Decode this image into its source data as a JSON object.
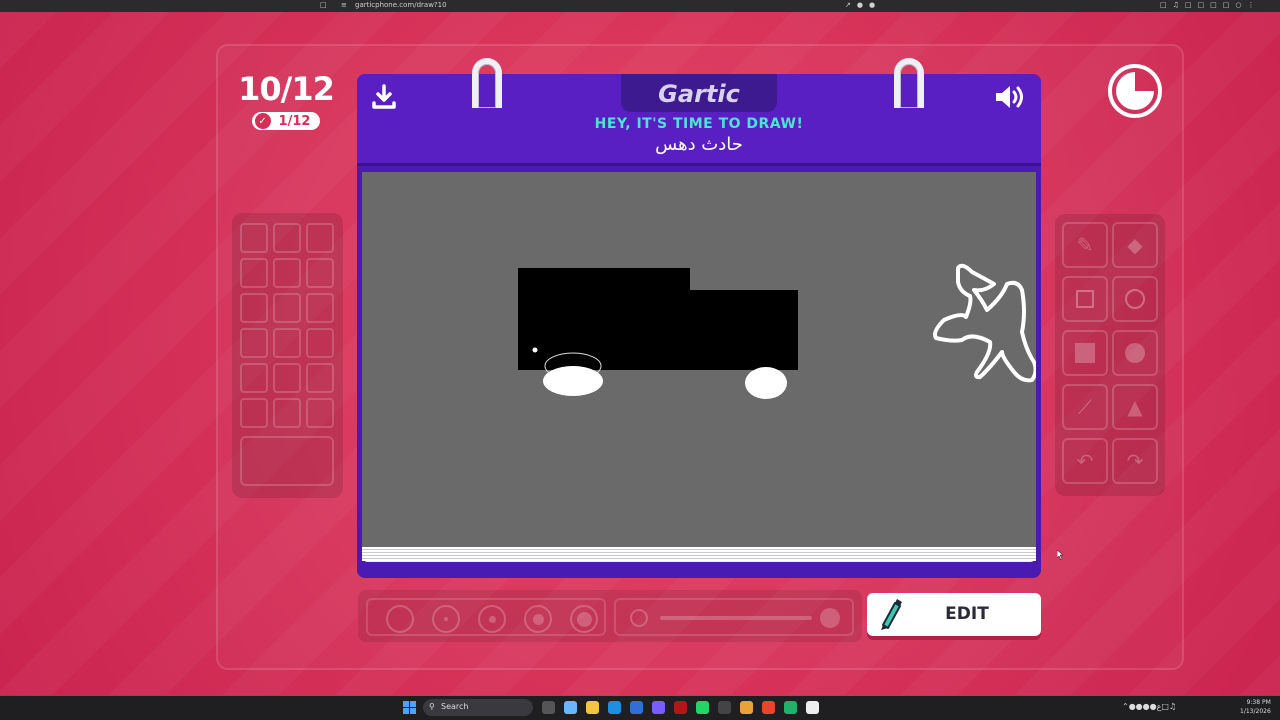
{
  "browser": {
    "url": "garticphone.com/draw?10",
    "bookmark_icon": "bookmark-icon",
    "security_icon": "tune-icon"
  },
  "game": {
    "round_label": "10/12",
    "done_label": "1/12",
    "logo": "Gartic",
    "prompt_heading": "HEY, IT'S TIME TO DRAW!",
    "prompt_word": "حادث دهس",
    "edit_label": "EDIT"
  },
  "colors": {
    "background": "#d8345a",
    "notebook": "#5a1fc2",
    "prompt_accent": "#4de3d2",
    "canvas": "#6a6a6a",
    "button_shadow": "#b81e45"
  },
  "icons": {
    "download": "download-icon",
    "sound": "speaker-icon",
    "timer": "timer-icon",
    "check": "check-icon",
    "pen": "pen-icon"
  },
  "tools": [
    "pencil-tool",
    "eraser-tool",
    "rectangle-tool",
    "ellipse-tool",
    "filled-rectangle-tool",
    "filled-ellipse-tool",
    "line-tool",
    "bucket-tool",
    "undo-tool",
    "redo-tool"
  ],
  "taskbar": {
    "search_label": "Search",
    "time": "9:38 PM",
    "date": "1/13/2026"
  }
}
